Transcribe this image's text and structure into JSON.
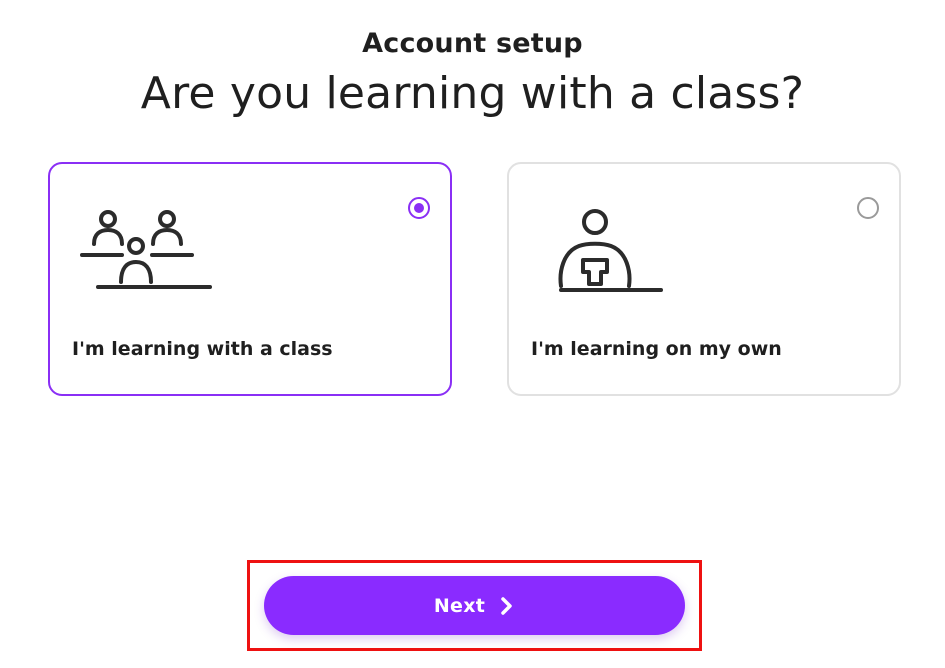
{
  "header": {
    "eyebrow": "Account setup",
    "title": "Are you learning with a class?"
  },
  "options": [
    {
      "label": "I'm learning with a class",
      "selected": true,
      "icon": "classroom-icon"
    },
    {
      "label": "I'm learning on my own",
      "selected": false,
      "icon": "solo-learner-icon"
    }
  ],
  "footer": {
    "next_label": "Next",
    "next_icon": "chevron-right-icon"
  },
  "colors": {
    "accent": "#8a2bff",
    "selected_border": "#8a2ff5",
    "unselected_border": "#e1e1e1",
    "highlight_outline": "#ee1111"
  }
}
